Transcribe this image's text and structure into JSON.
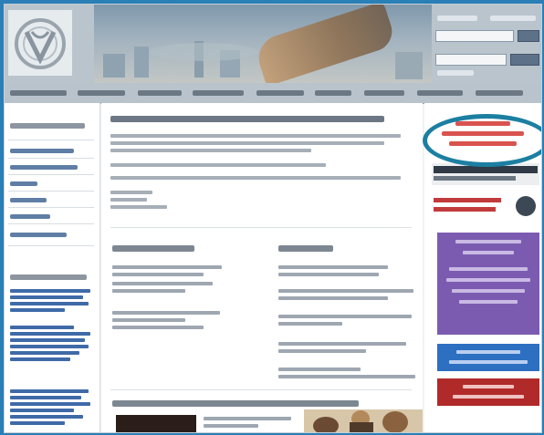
{
  "header": {
    "logo_icon": "organization-seal-icon",
    "banner_image": "hand-holding-pen-banner"
  },
  "nav": {
    "items": [
      "",
      "",
      "",
      "",
      "",
      "",
      "",
      "",
      ""
    ]
  },
  "left_sidebar": {
    "links": [
      "",
      "",
      "",
      "",
      "",
      ""
    ],
    "news_items": [
      "",
      "",
      "",
      "",
      ""
    ]
  },
  "main": {
    "heading": "",
    "sections": [
      "",
      ""
    ]
  },
  "right_sidebar": {
    "highlight_color": "#1c7fa2",
    "conference_link_color": "#d9534f",
    "panels": {
      "purple": "#7b5bb0",
      "blue": "#2d6fc1",
      "red": "#b12a2a"
    }
  },
  "colors": {
    "frame": "#2a7fb6",
    "link": "#3f6aa8"
  }
}
